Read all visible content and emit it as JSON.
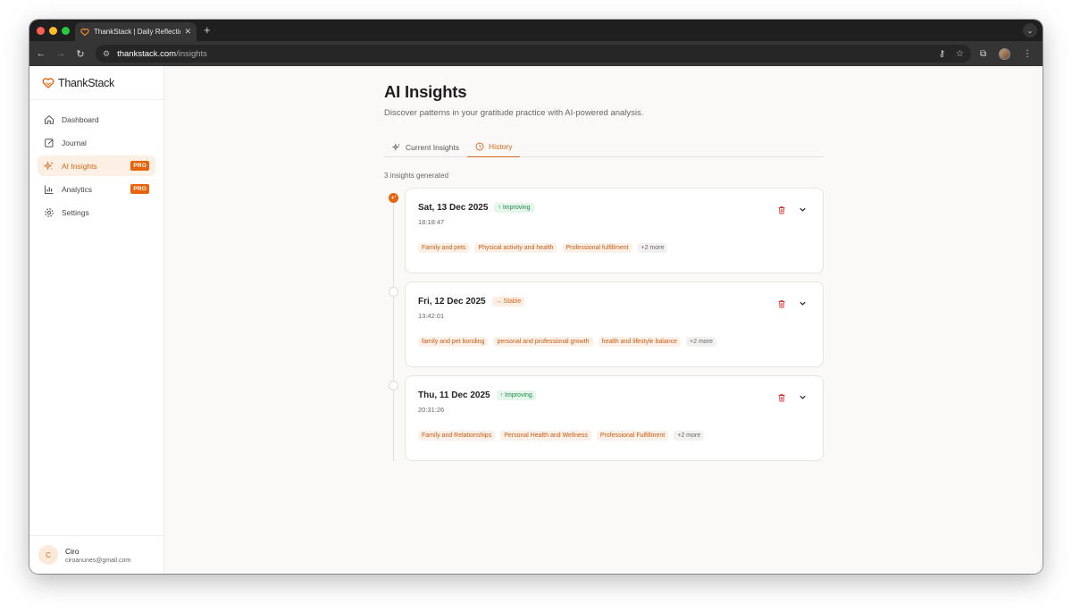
{
  "browser": {
    "tab_title": "ThankStack | Daily Reflection",
    "url_host": "thankstack.com",
    "url_path": "/insights"
  },
  "sidebar": {
    "brand": "ThankStack",
    "items": [
      {
        "label": "Dashboard",
        "icon": "home-icon"
      },
      {
        "label": "Journal",
        "icon": "journal-icon"
      },
      {
        "label": "AI Insights",
        "icon": "sparkles-icon",
        "badge": "PRO",
        "active": true
      },
      {
        "label": "Analytics",
        "icon": "bar-chart-icon",
        "badge": "PRO"
      },
      {
        "label": "Settings",
        "icon": "gear-icon"
      }
    ],
    "user": {
      "initial": "C",
      "name": "Ciro",
      "email": "ciroanunes@gmail.com"
    }
  },
  "main": {
    "title": "AI Insights",
    "subtitle": "Discover patterns in your gratitude practice with AI-powered analysis.",
    "tabs": [
      {
        "label": "Current Insights",
        "icon": "sparkles-icon"
      },
      {
        "label": "History",
        "icon": "clock-icon",
        "active": true
      }
    ],
    "count_text": "3 insights generated",
    "insights": [
      {
        "date": "Sat, 13 Dec 2025",
        "trend": "↑ Improving",
        "trend_type": "up",
        "time": "18:18:47",
        "tags": [
          "Family and pets",
          "Physical activity and health",
          "Professional fulfillment"
        ],
        "more": "+2 more"
      },
      {
        "date": "Fri, 12 Dec 2025",
        "trend": "→ Stable",
        "trend_type": "flat",
        "time": "13:42:01",
        "tags": [
          "family and pet bonding",
          "personal and professional growth",
          "health and lifestyle balance"
        ],
        "more": "+2 more"
      },
      {
        "date": "Thu, 11 Dec 2025",
        "trend": "↑ Improving",
        "trend_type": "up",
        "time": "20:31:26",
        "tags": [
          "Family and Relationships",
          "Personal Health and Wellness",
          "Professional Fulfillment"
        ],
        "more": "+2 more"
      }
    ]
  },
  "colors": {
    "accent": "#e8640c",
    "accent_text": "#d9681a",
    "improving": "#1e8a46",
    "delete_icon": "#d93b3b"
  }
}
